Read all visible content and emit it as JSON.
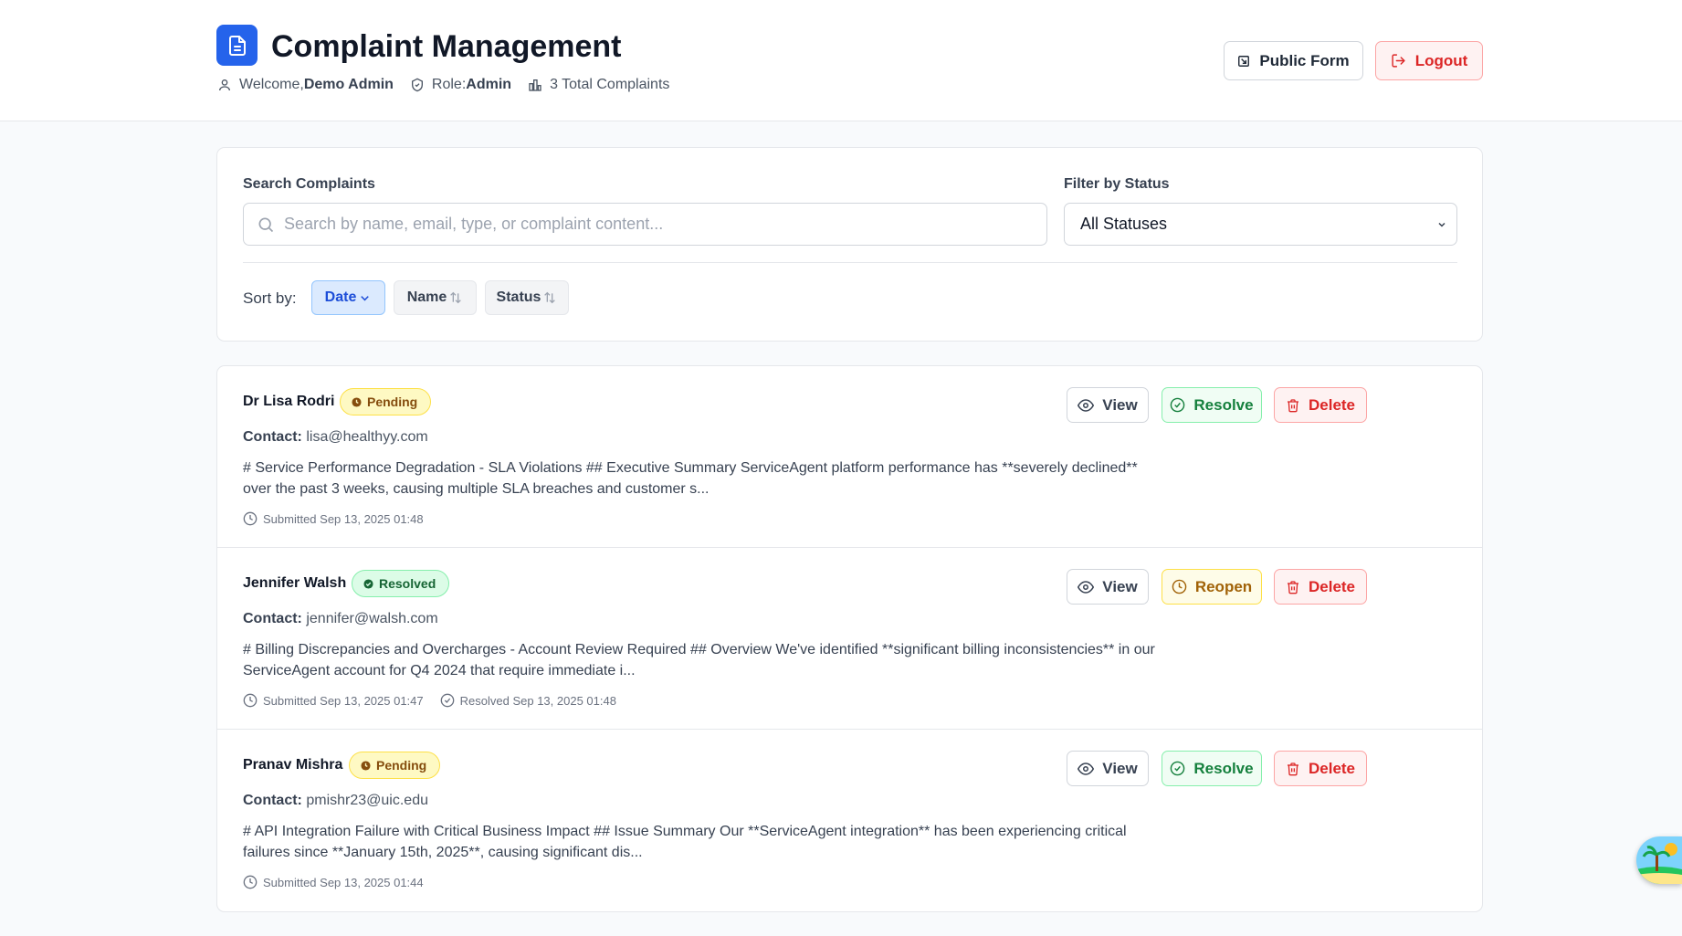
{
  "header": {
    "title": "Complaint Management",
    "welcome_prefix": "Welcome,",
    "user_name": "Demo Admin",
    "role_prefix": "Role:",
    "role": "Admin",
    "total_complaints": "3 Total Complaints",
    "public_form_label": "Public Form",
    "logout_label": "Logout"
  },
  "filters": {
    "search_label": "Search Complaints",
    "search_placeholder": "Search by name, email, type, or complaint content...",
    "search_value": "",
    "status_label": "Filter by Status",
    "status_selected": "All Statuses",
    "sort_label": "Sort by:",
    "sort_options": [
      {
        "label": "Date",
        "active": true
      },
      {
        "label": "Name",
        "active": false
      },
      {
        "label": "Status",
        "active": false
      }
    ]
  },
  "complaints": [
    {
      "name": "Dr Lisa Rodri",
      "status": "Pending",
      "contact_label": "Contact:",
      "email": "lisa@healthyy.com",
      "excerpt": "# Service Performance Degradation - SLA Violations ## Executive Summary ServiceAgent platform performance has **severely declined** over the past 3 weeks, causing multiple SLA breaches and customer s...",
      "submitted": "Submitted Sep 13, 2025 01:48",
      "resolved": "",
      "actions": {
        "view": "View",
        "toggle": "Resolve",
        "delete": "Delete"
      }
    },
    {
      "name": "Jennifer Walsh",
      "status": "Resolved",
      "contact_label": "Contact:",
      "email": "jennifer@walsh.com",
      "excerpt": "# Billing Discrepancies and Overcharges - Account Review Required ## Overview We've identified **significant billing inconsistencies** in our ServiceAgent account for Q4 2024 that require immediate i...",
      "submitted": "Submitted Sep 13, 2025 01:47",
      "resolved": "Resolved Sep 13, 2025 01:48",
      "actions": {
        "view": "View",
        "toggle": "Reopen",
        "delete": "Delete"
      }
    },
    {
      "name": "Pranav Mishra",
      "status": "Pending",
      "contact_label": "Contact:",
      "email": "pmishr23@uic.edu",
      "excerpt": "# API Integration Failure with Critical Business Impact ## Issue Summary Our **ServiceAgent integration** has been experiencing critical failures since **January 15th, 2025**, causing significant dis...",
      "submitted": "Submitted Sep 13, 2025 01:44",
      "resolved": "",
      "actions": {
        "view": "View",
        "toggle": "Resolve",
        "delete": "Delete"
      }
    }
  ],
  "colors": {
    "brand": "#2563eb",
    "pending": "#fef9c3",
    "resolved": "#dcfce7",
    "danger": "#dc2626",
    "success": "#15803d"
  },
  "icons": [
    "document-icon",
    "user-icon",
    "shield-icon",
    "chart-icon",
    "external-link-icon",
    "logout-icon",
    "search-icon",
    "chevron-down-icon",
    "sort-icon",
    "clock-icon",
    "check-circle-icon",
    "eye-icon",
    "trash-icon",
    "rotate-icon"
  ]
}
